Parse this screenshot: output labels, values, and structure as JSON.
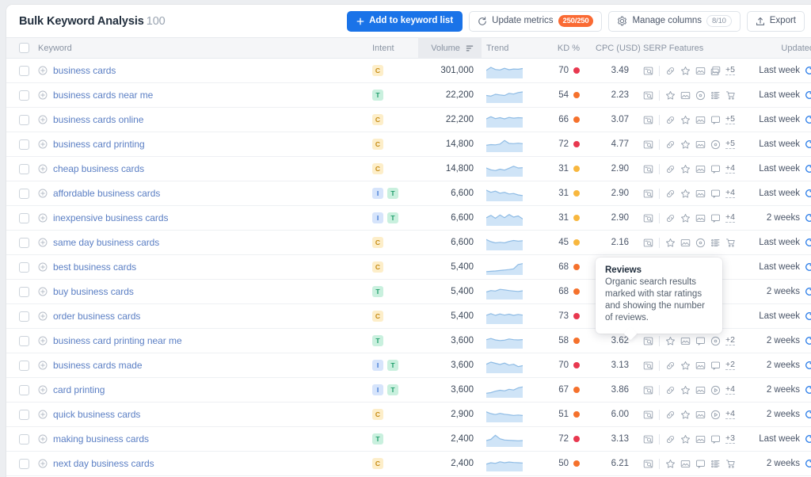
{
  "header": {
    "title": "Bulk Keyword Analysis",
    "count": "100",
    "add_to_list_label": "Add to keyword list",
    "update_metrics_label": "Update metrics",
    "update_metrics_badge": "250/250",
    "manage_columns_label": "Manage columns",
    "manage_columns_badge": "8/10",
    "export_label": "Export"
  },
  "columns": {
    "keyword": "Keyword",
    "intent": "Intent",
    "volume": "Volume",
    "trend": "Trend",
    "kd": "KD %",
    "cpc": "CPC (USD)",
    "serp": "SERP Features",
    "updated": "Updated"
  },
  "colors": {
    "accent": "#1a73e8",
    "badge_orange": "#fa6a33",
    "link": "#5b7fc4",
    "kd_red": "#e8384f",
    "kd_orange": "#f5712c",
    "kd_yellow": "#f8b73e"
  },
  "tooltip": {
    "title": "Reviews",
    "text": "Organic search results marked with star ratings and showing the number of reviews."
  },
  "rows": [
    {
      "keyword": "business cards",
      "intent": [
        "C"
      ],
      "volume": "301,000",
      "kd": "70",
      "kd_color": "#e8384f",
      "cpc": "3.49",
      "serp": [
        "search-preview",
        "divider",
        "link",
        "star",
        "image",
        "images"
      ],
      "more": "+5",
      "updated": "Last week",
      "trend": [
        0.55,
        0.8,
        0.62,
        0.58,
        0.72,
        0.6,
        0.66,
        0.64,
        0.7
      ]
    },
    {
      "keyword": "business cards near me",
      "intent": [
        "T"
      ],
      "volume": "22,200",
      "kd": "54",
      "kd_color": "#f5712c",
      "cpc": "2.23",
      "serp": [
        "search-preview",
        "divider",
        "star",
        "image",
        "local",
        "list",
        "shopping"
      ],
      "more": "",
      "updated": "Last week",
      "trend": [
        0.5,
        0.45,
        0.6,
        0.55,
        0.5,
        0.68,
        0.62,
        0.75,
        0.8
      ]
    },
    {
      "keyword": "business cards online",
      "intent": [
        "C"
      ],
      "volume": "22,200",
      "kd": "66",
      "kd_color": "#f5712c",
      "cpc": "3.07",
      "serp": [
        "search-preview",
        "divider",
        "link",
        "star",
        "image",
        "comment"
      ],
      "more": "+5",
      "updated": "Last week",
      "trend": [
        0.6,
        0.78,
        0.62,
        0.7,
        0.6,
        0.72,
        0.66,
        0.7,
        0.68
      ]
    },
    {
      "keyword": "business card printing",
      "intent": [
        "C"
      ],
      "volume": "14,800",
      "kd": "72",
      "kd_color": "#e8384f",
      "cpc": "4.77",
      "serp": [
        "search-preview",
        "divider",
        "link",
        "star",
        "image",
        "local"
      ],
      "more": "+5",
      "updated": "Last week",
      "trend": [
        0.45,
        0.5,
        0.48,
        0.55,
        0.85,
        0.6,
        0.58,
        0.62,
        0.58
      ]
    },
    {
      "keyword": "cheap business cards",
      "intent": [
        "C"
      ],
      "volume": "14,800",
      "kd": "31",
      "kd_color": "#f8b73e",
      "cpc": "2.90",
      "serp": [
        "search-preview",
        "divider",
        "link",
        "star",
        "image",
        "comment"
      ],
      "more": "+4",
      "updated": "Last week",
      "trend": [
        0.6,
        0.45,
        0.38,
        0.5,
        0.42,
        0.58,
        0.75,
        0.6,
        0.62
      ]
    },
    {
      "keyword": "affordable business cards",
      "intent": [
        "I",
        "T"
      ],
      "volume": "6,600",
      "kd": "31",
      "kd_color": "#f8b73e",
      "cpc": "2.90",
      "serp": [
        "search-preview",
        "divider",
        "link",
        "star",
        "image",
        "comment"
      ],
      "more": "+4",
      "updated": "Last week",
      "trend": [
        0.8,
        0.62,
        0.72,
        0.55,
        0.62,
        0.48,
        0.52,
        0.4,
        0.35
      ]
    },
    {
      "keyword": "inexpensive business cards",
      "intent": [
        "I",
        "T"
      ],
      "volume": "6,600",
      "kd": "31",
      "kd_color": "#f8b73e",
      "cpc": "2.90",
      "serp": [
        "search-preview",
        "divider",
        "link",
        "star",
        "image",
        "comment"
      ],
      "more": "+4",
      "updated": "2 weeks",
      "trend": [
        0.55,
        0.75,
        0.5,
        0.78,
        0.55,
        0.82,
        0.6,
        0.7,
        0.45
      ]
    },
    {
      "keyword": "same day business cards",
      "intent": [
        "C"
      ],
      "volume": "6,600",
      "kd": "45",
      "kd_color": "#f8b73e",
      "cpc": "2.16",
      "serp": [
        "search-preview",
        "divider",
        "star",
        "image",
        "local",
        "list",
        "shopping"
      ],
      "more": "",
      "updated": "Last week",
      "trend": [
        0.78,
        0.6,
        0.5,
        0.55,
        0.5,
        0.62,
        0.7,
        0.65,
        0.68
      ]
    },
    {
      "keyword": "best business cards",
      "intent": [
        "C"
      ],
      "volume": "5,400",
      "kd": "68",
      "kd_color": "#f5712c",
      "cpc": "",
      "serp": [],
      "more": "",
      "updated": "Last week",
      "trend": [
        0.15,
        0.17,
        0.2,
        0.24,
        0.28,
        0.32,
        0.38,
        0.75,
        0.82
      ]
    },
    {
      "keyword": "buy business cards",
      "intent": [
        "T"
      ],
      "volume": "5,400",
      "kd": "68",
      "kd_color": "#f5712c",
      "cpc": "",
      "serp": [],
      "more": "",
      "updated": "2 weeks",
      "trend": [
        0.5,
        0.62,
        0.58,
        0.72,
        0.68,
        0.62,
        0.58,
        0.55,
        0.6
      ]
    },
    {
      "keyword": "order business cards",
      "intent": [
        "C"
      ],
      "volume": "5,400",
      "kd": "73",
      "kd_color": "#e8384f",
      "cpc": "",
      "serp": [],
      "more": "",
      "updated": "Last week",
      "trend": [
        0.6,
        0.75,
        0.6,
        0.72,
        0.62,
        0.7,
        0.6,
        0.68,
        0.62
      ]
    },
    {
      "keyword": "business card printing near me",
      "intent": [
        "T"
      ],
      "volume": "3,600",
      "kd": "58",
      "kd_color": "#f5712c",
      "cpc": "3.62",
      "serp": [
        "search-preview",
        "divider",
        "star",
        "image",
        "comment",
        "local"
      ],
      "more": "+2",
      "updated": "2 weeks",
      "trend": [
        0.62,
        0.72,
        0.6,
        0.55,
        0.58,
        0.68,
        0.62,
        0.6,
        0.63
      ]
    },
    {
      "keyword": "business cards made",
      "intent": [
        "I",
        "T"
      ],
      "volume": "3,600",
      "kd": "70",
      "kd_color": "#e8384f",
      "cpc": "3.13",
      "serp": [
        "search-preview",
        "divider",
        "link",
        "star",
        "image",
        "comment"
      ],
      "more": "+2",
      "updated": "2 weeks",
      "trend": [
        0.62,
        0.8,
        0.7,
        0.6,
        0.72,
        0.55,
        0.62,
        0.42,
        0.5
      ]
    },
    {
      "keyword": "card printing",
      "intent": [
        "I",
        "T"
      ],
      "volume": "3,600",
      "kd": "67",
      "kd_color": "#f5712c",
      "cpc": "3.86",
      "serp": [
        "search-preview",
        "divider",
        "link",
        "star",
        "image",
        "video"
      ],
      "more": "+4",
      "updated": "2 weeks",
      "trend": [
        0.25,
        0.3,
        0.42,
        0.5,
        0.45,
        0.58,
        0.52,
        0.7,
        0.78
      ]
    },
    {
      "keyword": "quick business cards",
      "intent": [
        "C"
      ],
      "volume": "2,900",
      "kd": "51",
      "kd_color": "#f5712c",
      "cpc": "6.00",
      "serp": [
        "search-preview",
        "divider",
        "link",
        "star",
        "image",
        "video"
      ],
      "more": "+4",
      "updated": "2 weeks",
      "trend": [
        0.75,
        0.6,
        0.52,
        0.62,
        0.55,
        0.5,
        0.45,
        0.48,
        0.44
      ]
    },
    {
      "keyword": "making business cards",
      "intent": [
        "T"
      ],
      "volume": "2,400",
      "kd": "72",
      "kd_color": "#e8384f",
      "cpc": "3.13",
      "serp": [
        "search-preview",
        "divider",
        "link",
        "star",
        "image",
        "comment"
      ],
      "more": "+3",
      "updated": "Last week",
      "trend": [
        0.4,
        0.5,
        0.85,
        0.55,
        0.45,
        0.42,
        0.4,
        0.38,
        0.4
      ]
    },
    {
      "keyword": "next day business cards",
      "intent": [
        "C"
      ],
      "volume": "2,400",
      "kd": "50",
      "kd_color": "#f5712c",
      "cpc": "6.21",
      "serp": [
        "search-preview",
        "divider",
        "star",
        "image",
        "comment",
        "list",
        "shopping"
      ],
      "more": "",
      "updated": "2 weeks",
      "trend": [
        0.48,
        0.6,
        0.55,
        0.68,
        0.6,
        0.66,
        0.62,
        0.6,
        0.58
      ]
    }
  ]
}
